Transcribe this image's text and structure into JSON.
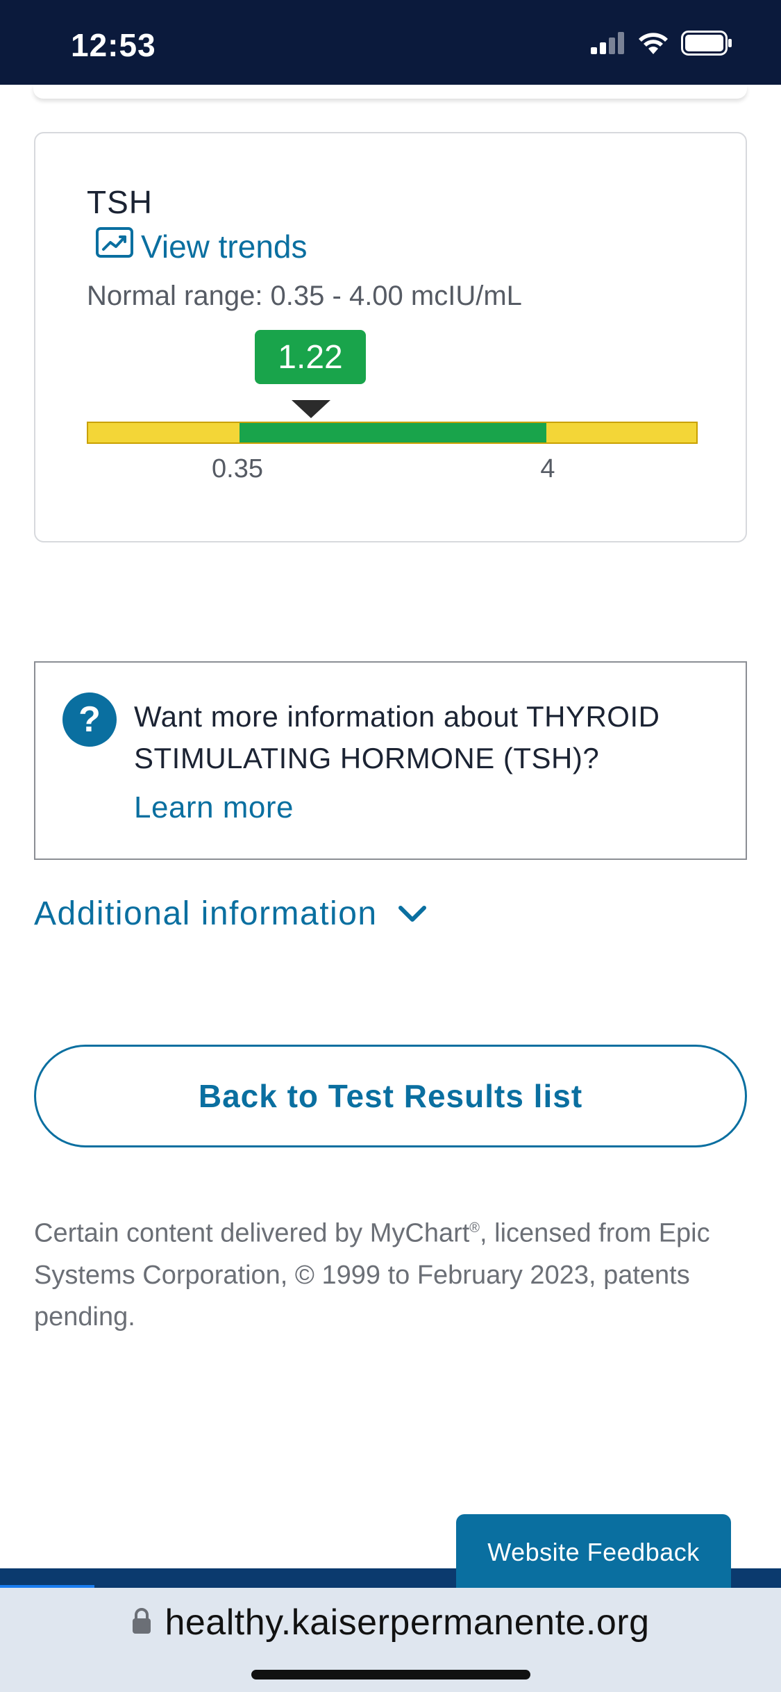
{
  "status_bar": {
    "time": "12:53"
  },
  "result": {
    "test_name": "TSH",
    "view_trends_label": "View trends",
    "normal_range_text": "Normal range: 0.35 - 4.00 mcIU/mL",
    "value": "1.22",
    "range_low_tick": "0.35",
    "range_high_tick": "4",
    "colors": {
      "normal": "#19a44b",
      "out_of_range": "#f3d637"
    }
  },
  "info_box": {
    "text": "Want more information about THYROID STIMULATING HORMONE (TSH)?",
    "learn_more_label": "Learn more"
  },
  "additional_info_label": "Additional information",
  "back_button_label": "Back to Test Results list",
  "copyright": {
    "line_before": "Certain content delivered by MyChart",
    "reg_mark": "®",
    "line_after": ", licensed from Epic Systems Corporation, © 1999 to February 2023, patents pending."
  },
  "feedback_label": "Website Feedback",
  "browser": {
    "url": "healthy.kaiserpermanente.org"
  },
  "accent_color": "#0a6fa0"
}
